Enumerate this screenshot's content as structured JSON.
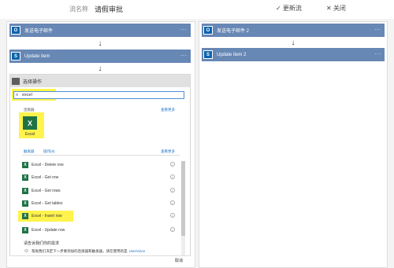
{
  "header": {
    "name_label": "流名称",
    "flow_name": "请假审批",
    "update_label": "✓ 更新流",
    "close_label": "✕ 关闭"
  },
  "left": {
    "step1": "发送电子邮件",
    "step2": "Update item",
    "more": "···"
  },
  "right": {
    "step1": "发送电子邮件 2",
    "step2": "Update item 2",
    "more": "···"
  },
  "panel": {
    "title": "选择操作",
    "search_value": "excel",
    "connectors_label": "连接器",
    "see_more_1": "查看更多",
    "excel_label": "Excel",
    "tab_all": "触发器",
    "tab_actions": "操作(9)",
    "see_more_2": "查看更多",
    "actions": [
      "Excel - Delete row",
      "Excel - Get row",
      "Excel - Get rows",
      "Excel - Get tables",
      "Excel - Insert row",
      "Excel - Update row"
    ],
    "info_glyph": "i",
    "feedback_title": "请告诉我们你的需求",
    "feedback_text": "帮助我们决定下一步要添加的连接器和触发器，请在使用的是",
    "feedback_link": "UserVoice",
    "cancel": "取消"
  },
  "colors": {
    "step": "#6787b4",
    "highlight": "#fff34c",
    "excel": "#207245",
    "outlook": "#0a64ad"
  }
}
